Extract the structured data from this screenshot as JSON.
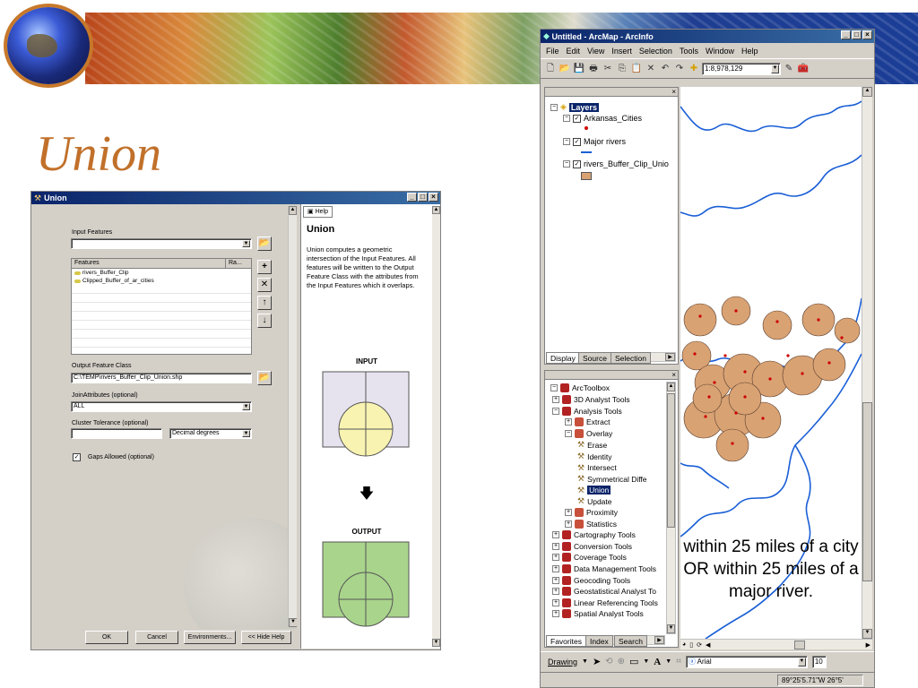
{
  "slide": {
    "title": "Union",
    "caption": "within 25 miles of a city OR within 25 miles of a major river."
  },
  "union_dialog": {
    "window_title": "Union",
    "input_features_label": "Input Features",
    "table_header_features": "Features",
    "table_header_rank": "Ra...",
    "table_rows": [
      "rivers_Buffer_Clip",
      "Clipped_Buffer_of_ar_cities"
    ],
    "output_label": "Output Feature Class",
    "output_value": "C:\\TEMP\\rivers_Buffer_Clip_Union.shp",
    "join_label": "JoinAttributes (optional)",
    "join_value": "ALL",
    "cluster_label": "Cluster Tolerance (optional)",
    "cluster_unit": "Decimal degrees",
    "gaps_label": "Gaps Allowed (optional)",
    "gaps_checked": true,
    "buttons": {
      "ok": "OK",
      "cancel": "Cancel",
      "environments": "Environments...",
      "hide_help": "<< Hide Help"
    },
    "help": {
      "tab_label": "Help",
      "title": "Union",
      "text": "Union computes a geometric intersection of the Input Features. All features will be written to the Output Feature Class with the attributes from the Input Features which it overlaps.",
      "input_label": "INPUT",
      "output_label": "OUTPUT"
    }
  },
  "arcmap": {
    "window_title": "Untitled - ArcMap - ArcInfo",
    "menu": [
      "File",
      "Edit",
      "View",
      "Insert",
      "Selection",
      "Tools",
      "Window",
      "Help"
    ],
    "scale": "1:8,978,129",
    "toc": {
      "root": "Layers",
      "layers": [
        "Arkansas_Cities",
        "Major rivers",
        "rivers_Buffer_Clip_Unio"
      ]
    },
    "toc_tabs": [
      "Display",
      "Source",
      "Selection"
    ],
    "toolbox": {
      "root": "ArcToolbox",
      "items": [
        {
          "label": "3D Analyst Tools",
          "level": 0,
          "kind": "toolbox"
        },
        {
          "label": "Analysis Tools",
          "level": 0,
          "kind": "toolbox"
        },
        {
          "label": "Extract",
          "level": 1,
          "kind": "toolset"
        },
        {
          "label": "Overlay",
          "level": 1,
          "kind": "toolset"
        },
        {
          "label": "Erase",
          "level": 2,
          "kind": "tool"
        },
        {
          "label": "Identity",
          "level": 2,
          "kind": "tool"
        },
        {
          "label": "Intersect",
          "level": 2,
          "kind": "tool"
        },
        {
          "label": "Symmetrical Diffe",
          "level": 2,
          "kind": "tool"
        },
        {
          "label": "Union",
          "level": 2,
          "kind": "tool",
          "selected": true
        },
        {
          "label": "Update",
          "level": 2,
          "kind": "tool"
        },
        {
          "label": "Proximity",
          "level": 1,
          "kind": "toolset"
        },
        {
          "label": "Statistics",
          "level": 1,
          "kind": "toolset"
        },
        {
          "label": "Cartography Tools",
          "level": 0,
          "kind": "toolbox"
        },
        {
          "label": "Conversion Tools",
          "level": 0,
          "kind": "toolbox"
        },
        {
          "label": "Coverage Tools",
          "level": 0,
          "kind": "toolbox"
        },
        {
          "label": "Data Management Tools",
          "level": 0,
          "kind": "toolbox"
        },
        {
          "label": "Geocoding Tools",
          "level": 0,
          "kind": "toolbox"
        },
        {
          "label": "Geostatistical Analyst To",
          "level": 0,
          "kind": "toolbox"
        },
        {
          "label": "Linear Referencing Tools",
          "level": 0,
          "kind": "toolbox"
        },
        {
          "label": "Spatial Analyst Tools",
          "level": 0,
          "kind": "toolbox"
        }
      ]
    },
    "toolbox_tabs": [
      "Favorites",
      "Index",
      "Search"
    ],
    "drawing_label": "Drawing",
    "font_name": "Arial",
    "font_size": "10",
    "status_coords": "89°25'5.71\"W 26°5'",
    "colors": {
      "river": "#1a5fd6",
      "buffer": "#d9a273",
      "city": "#cc0000"
    }
  }
}
